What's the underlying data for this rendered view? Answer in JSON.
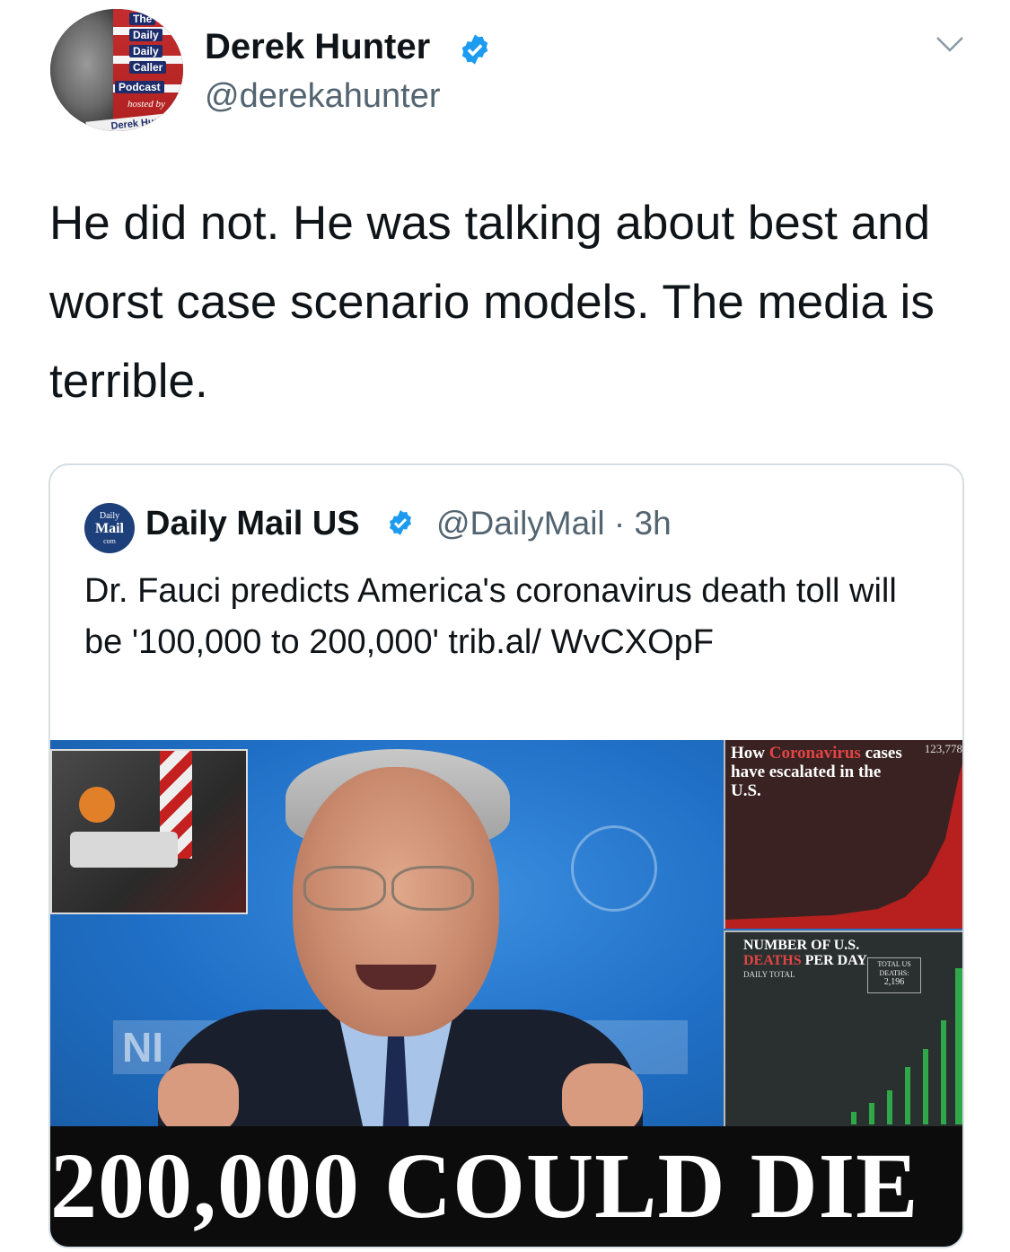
{
  "author": {
    "name": "Derek Hunter",
    "handle": "@derekahunter",
    "avatar_badge": {
      "words": [
        "The",
        "Daily",
        "Daily",
        "Caller",
        "Podcast"
      ],
      "hosted_by": "hosted by",
      "host": "Derek Hun"
    },
    "verified_icon": "verified-badge-icon",
    "verified_color": "#1d9bf0"
  },
  "menu_icon": "chevron-down-icon",
  "tweet_text": "He did not. He was talking about best and worst case scenario models. The media is terrible.",
  "quoted": {
    "avatar_text": {
      "top": "Daily",
      "main": "Mail",
      "bottom": "com"
    },
    "name": "Daily Mail US",
    "handle": "@DailyMail",
    "separator": "·",
    "time": "3h",
    "text": "Dr. Fauci predicts America's coronavirus death toll will be '100,000 to 200,000' trib.al/ WvCXOpF",
    "media": {
      "headline": "200,000 COULD DIE",
      "backdrop_text": "NI",
      "chart_cases": {
        "title_prefix": "How ",
        "title_highlight": "Coronavirus",
        "title_rest": " cases have escalated in the U.S.",
        "total": "123,778"
      },
      "chart_deaths": {
        "title_line1": "NUMBER OF U.S.",
        "title_highlight": "DEATHS",
        "title_rest": " PER DAY",
        "subtitle": "DAILY TOTAL",
        "total_label": "TOTAL US DEATHS:",
        "total_value": "2,196"
      }
    }
  },
  "colors": {
    "text_primary": "#0f1419",
    "text_secondary": "#536471",
    "border": "#d7dee3",
    "accent": "#1d9bf0"
  }
}
